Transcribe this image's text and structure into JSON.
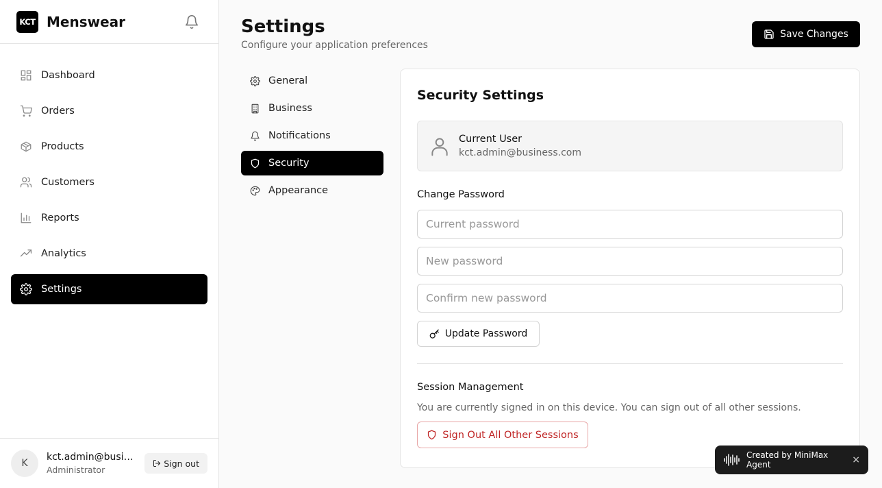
{
  "brand": {
    "logo_text": "KCT",
    "name": "Menswear"
  },
  "sidebar": {
    "items": [
      {
        "label": "Dashboard",
        "icon": "dashboard-icon"
      },
      {
        "label": "Orders",
        "icon": "cart-icon"
      },
      {
        "label": "Products",
        "icon": "package-icon"
      },
      {
        "label": "Customers",
        "icon": "users-icon"
      },
      {
        "label": "Reports",
        "icon": "bar-chart-icon"
      },
      {
        "label": "Analytics",
        "icon": "trending-up-icon"
      },
      {
        "label": "Settings",
        "icon": "gear-icon",
        "active": true
      }
    ]
  },
  "user": {
    "initial": "K",
    "email": "kct.admin@business.com",
    "role": "Administrator",
    "signout_label": "Sign out"
  },
  "header": {
    "title": "Settings",
    "subtitle": "Configure your application preferences",
    "save_label": "Save Changes"
  },
  "settings_nav": {
    "items": [
      {
        "label": "General",
        "icon": "gear-icon"
      },
      {
        "label": "Business",
        "icon": "building-icon"
      },
      {
        "label": "Notifications",
        "icon": "bell-icon"
      },
      {
        "label": "Security",
        "icon": "shield-icon",
        "active": true
      },
      {
        "label": "Appearance",
        "icon": "palette-icon"
      }
    ]
  },
  "security": {
    "title": "Security Settings",
    "current_user_label": "Current User",
    "current_user_email": "kct.admin@business.com",
    "change_password_label": "Change Password",
    "current_password_placeholder": "Current password",
    "new_password_placeholder": "New password",
    "confirm_password_placeholder": "Confirm new password",
    "update_password_label": "Update Password",
    "session_title": "Session Management",
    "session_desc": "You are currently signed in on this device. You can sign out of all other sessions.",
    "signout_all_label": "Sign Out All Other Sessions"
  },
  "toast": {
    "text": "Created by MiniMax Agent",
    "close": "×"
  },
  "colors": {
    "accent": "#000000",
    "danger": "#c02626",
    "background": "#fafafa"
  }
}
